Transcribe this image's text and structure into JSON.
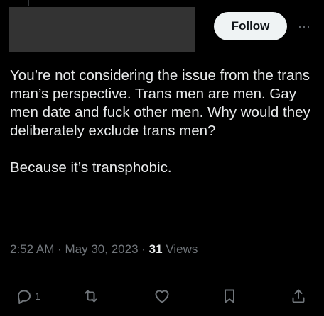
{
  "header": {
    "follow_label": "Follow",
    "more_label": "···"
  },
  "post": {
    "text": "You’re not considering the issue from the trans man’s perspective. Trans men are men. Gay men date and fuck other men. Why would they deliberately exclude trans men?\n\nBecause it’s transphobic."
  },
  "meta": {
    "time": "2:52 AM",
    "separator": "·",
    "date": "May 30, 2023",
    "views_count": "31",
    "views_label": "Views"
  },
  "actions": {
    "reply_count": "1"
  },
  "colors": {
    "background": "#000000",
    "text": "#e7e9ea",
    "muted": "#71767b",
    "button_bg": "#eff3f4",
    "redacted": "#333333"
  }
}
